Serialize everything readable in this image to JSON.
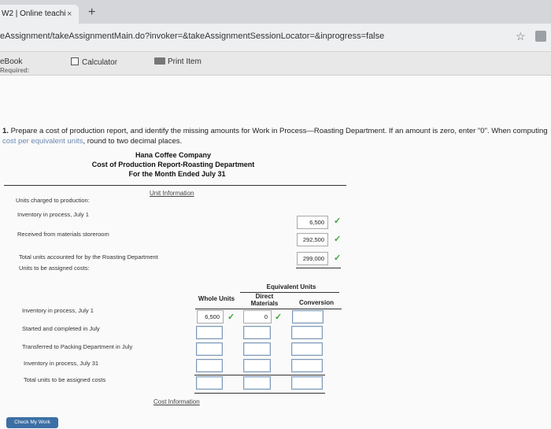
{
  "browser": {
    "tab_title": "W2 | Online teachi",
    "tab_close": "×",
    "new_tab": "+",
    "url": "eAssignment/takeAssignmentMain.do?invoker=&takeAssignmentSessionLocator=&inprogress=false"
  },
  "toolbar": {
    "ebook": "eBook",
    "calculator": "Calculator",
    "print_item": "Print Item",
    "required": "Required:"
  },
  "instructions": {
    "number": "1.",
    "text_before": "Prepare a cost of production report, and identify the missing amounts for Work in Process—Roasting Department. If an amount is zero, enter \"0\". When computing ",
    "highlight": "cost per equivalent units",
    "text_after": ", round to two decimal places."
  },
  "report": {
    "company": "Hana Coffee Company",
    "title": "Cost of Production Report-Roasting Department",
    "period": "For the Month Ended July 31",
    "unit_info_link": "Unit Information",
    "cost_info_link": "Cost Information"
  },
  "units_charged": {
    "heading": "Units charged to production:",
    "rows": [
      {
        "label": "Inventory in process, July 1",
        "value": "6,500"
      },
      {
        "label": "Received from materials storeroom",
        "value": "292,500"
      },
      {
        "label": "Total units accounted for by the Roasting Department",
        "value": "299,000"
      }
    ],
    "assigned_heading": "Units to be assigned costs:"
  },
  "equivalent_units": {
    "group_header": "Equivalent Units",
    "col_whole": "Whole Units",
    "col_direct": "Direct Materials",
    "col_conversion": "Conversion",
    "rows": [
      {
        "label": "Inventory in process, July 1",
        "whole": "6,500",
        "direct": "0"
      },
      {
        "label": "Started and completed in July"
      },
      {
        "label": "Transferred to Packing Department in July"
      },
      {
        "label": "Inventory in process, July 31"
      },
      {
        "label": "Total units to be assigned costs"
      }
    ]
  },
  "footer": {
    "check_button": "Check My Work"
  }
}
